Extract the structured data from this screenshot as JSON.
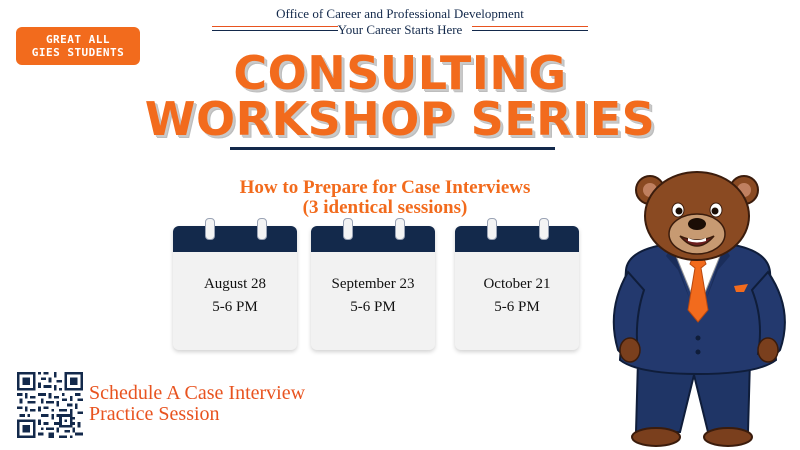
{
  "badge": {
    "line1": "GREAT ALL",
    "line2": "GIES STUDENTS"
  },
  "header": {
    "office": "Office of Career and Professional Development",
    "tagline": "Your Career Starts Here"
  },
  "title": {
    "line1": "CONSULTING",
    "line2": "WORKSHOP SERIES"
  },
  "subtitle": {
    "line1": "How to Prepare for Case Interviews",
    "line2": "(3 identical sessions)"
  },
  "sessions": [
    {
      "date": "August 28",
      "time": "5-6 PM"
    },
    {
      "date": "September 23",
      "time": "5-6 PM"
    },
    {
      "date": "October 21",
      "time": "5-6 PM"
    }
  ],
  "qr": {
    "line1": "Schedule A Case Interview",
    "line2": "Practice Session"
  },
  "colors": {
    "orange": "#f26b1d",
    "navy": "#13294b"
  }
}
